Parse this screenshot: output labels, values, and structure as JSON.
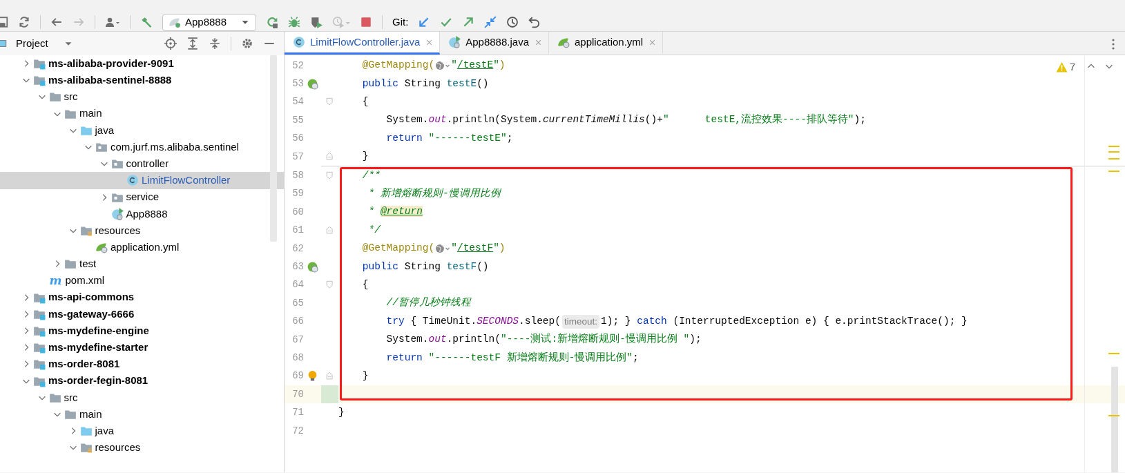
{
  "toolbar": {
    "buttons": [
      {
        "kind": "save",
        "disabled": false
      },
      {
        "kind": "sync",
        "disabled": false
      },
      {
        "kind": "separator"
      },
      {
        "kind": "back",
        "disabled": false
      },
      {
        "kind": "forward",
        "disabled": true
      },
      {
        "kind": "separator"
      },
      {
        "kind": "user",
        "disabled": false
      },
      {
        "kind": "separator"
      },
      {
        "kind": "build",
        "disabled": false
      },
      {
        "kind": "run-config",
        "label": "App8888"
      },
      {
        "kind": "rerun",
        "disabled": false
      },
      {
        "kind": "debug",
        "disabled": false
      },
      {
        "kind": "coverage",
        "disabled": false
      },
      {
        "kind": "profile",
        "disabled": true
      },
      {
        "kind": "stop",
        "disabled": false
      },
      {
        "kind": "separator"
      },
      {
        "kind": "label",
        "label": "Git:"
      },
      {
        "kind": "update",
        "disabled": false
      },
      {
        "kind": "commit",
        "disabled": false
      },
      {
        "kind": "push",
        "disabled": false
      },
      {
        "kind": "merge",
        "disabled": false
      },
      {
        "kind": "history",
        "disabled": false
      },
      {
        "kind": "revert",
        "disabled": false
      }
    ]
  },
  "project_panel": {
    "title": "Project",
    "tree": [
      {
        "name": "ms-alibaba-provider-9091",
        "kind": "module",
        "expanded": false,
        "selected": false
      },
      {
        "name": "ms-alibaba-sentinel-8888",
        "kind": "module",
        "expanded": true,
        "selected": false,
        "children": [
          {
            "name": "src",
            "kind": "folder",
            "expanded": true,
            "selected": false,
            "children": [
              {
                "name": "main",
                "kind": "folder",
                "expanded": true,
                "selected": false,
                "children": [
                  {
                    "name": "java",
                    "kind": "source-root",
                    "expanded": true,
                    "selected": false,
                    "children": [
                      {
                        "name": "com.jurf.ms.alibaba.sentinel",
                        "kind": "package",
                        "expanded": true,
                        "selected": false,
                        "children": [
                          {
                            "name": "controller",
                            "kind": "package",
                            "expanded": true,
                            "selected": false,
                            "children": [
                              {
                                "name": "LimitFlowController",
                                "kind": "class",
                                "selected": true
                              }
                            ]
                          },
                          {
                            "name": "service",
                            "kind": "package",
                            "expanded": false,
                            "selected": false
                          },
                          {
                            "name": "App8888",
                            "kind": "app-class",
                            "selected": false
                          }
                        ]
                      }
                    ]
                  },
                  {
                    "name": "resources",
                    "kind": "resources",
                    "expanded": true,
                    "selected": false,
                    "children": [
                      {
                        "name": "application.yml",
                        "kind": "yml",
                        "selected": false
                      }
                    ]
                  }
                ]
              },
              {
                "name": "test",
                "kind": "folder",
                "expanded": false,
                "selected": false
              }
            ]
          },
          {
            "name": "pom.xml",
            "kind": "maven",
            "icon_text": "m",
            "selected": false
          }
        ]
      },
      {
        "name": "ms-api-commons",
        "kind": "module",
        "expanded": false,
        "selected": false
      },
      {
        "name": "ms-gateway-6666",
        "kind": "module",
        "expanded": false,
        "selected": false
      },
      {
        "name": "ms-mydefine-engine",
        "kind": "module",
        "expanded": false,
        "selected": false
      },
      {
        "name": "ms-mydefine-starter",
        "kind": "module",
        "expanded": false,
        "selected": false
      },
      {
        "name": "ms-order-8081",
        "kind": "module",
        "expanded": false,
        "selected": false
      },
      {
        "name": "ms-order-fegin-8081",
        "kind": "module",
        "expanded": true,
        "selected": false,
        "children": [
          {
            "name": "src",
            "kind": "folder",
            "expanded": true,
            "selected": false,
            "children": [
              {
                "name": "main",
                "kind": "folder",
                "expanded": true,
                "selected": false,
                "children": [
                  {
                    "name": "java",
                    "kind": "source-root",
                    "expanded": false,
                    "selected": false
                  },
                  {
                    "name": "resources",
                    "kind": "resources",
                    "expanded": true,
                    "selected": false
                  }
                ]
              }
            ]
          }
        ]
      }
    ]
  },
  "editor": {
    "tabs": [
      {
        "label": "LimitFlowController.java",
        "kind": "class",
        "selected": true
      },
      {
        "label": "App8888.java",
        "kind": "app-class",
        "selected": false
      },
      {
        "label": "application.yml",
        "kind": "yml",
        "selected": false
      }
    ],
    "warnings": "7",
    "blocks": [
      {
        "highlighted": false,
        "separator_before": false,
        "lines": [
          {
            "number": "52",
            "current": false,
            "changed": false,
            "tokens": [
              {
                "kind": "anno",
                "text": "    @GetMapping("
              },
              {
                "kind": "globe"
              },
              {
                "kind": "str",
                "text": "\""
              },
              {
                "kind": "url",
                "text": "/testE"
              },
              {
                "kind": "str",
                "text": "\""
              },
              {
                "kind": "anno",
                "text": ")"
              }
            ]
          },
          {
            "number": "53",
            "gutter": {
              "kind": "run"
            },
            "current": false,
            "changed": false,
            "tokens": [
              {
                "kind": "kw",
                "text": "    public "
              },
              {
                "kind": "plain",
                "text": "String "
              },
              {
                "kind": "decl",
                "text": "testE"
              },
              {
                "kind": "plain",
                "text": "()"
              }
            ]
          },
          {
            "number": "54",
            "fold": {
              "kind": "start"
            },
            "current": false,
            "changed": false,
            "tokens": [
              {
                "kind": "plain",
                "text": "    {"
              }
            ]
          },
          {
            "number": "55",
            "current": false,
            "changed": false,
            "tokens": [
              {
                "kind": "plain",
                "text": "        System."
              },
              {
                "kind": "sf",
                "text": "out"
              },
              {
                "kind": "plain",
                "text": ".println(System."
              },
              {
                "kind": "sm",
                "text": "currentTimeMillis"
              },
              {
                "kind": "plain",
                "text": "()+"
              },
              {
                "kind": "str",
                "text": "\"      testE,流控效果----排队等待\""
              },
              {
                "kind": "plain",
                "text": ");"
              }
            ]
          },
          {
            "number": "56",
            "current": false,
            "changed": false,
            "tokens": [
              {
                "kind": "kw",
                "text": "        return "
              },
              {
                "kind": "str",
                "text": "\"------testE\""
              },
              {
                "kind": "plain",
                "text": ";"
              }
            ]
          },
          {
            "number": "57",
            "fold": {
              "kind": "end"
            },
            "current": false,
            "changed": false,
            "tokens": [
              {
                "kind": "plain",
                "text": "    }"
              }
            ]
          }
        ]
      },
      {
        "highlighted": true,
        "separator_before": true,
        "lines": [
          {
            "number": "58",
            "fold": {
              "kind": "start"
            },
            "current": false,
            "changed": false,
            "tokens": [
              {
                "kind": "doc",
                "text": "    /**"
              }
            ]
          },
          {
            "number": "59",
            "current": false,
            "changed": false,
            "tokens": [
              {
                "kind": "doc",
                "text": "     * 新增熔断规则-慢调用比例"
              }
            ]
          },
          {
            "number": "60",
            "current": false,
            "changed": false,
            "tokens": [
              {
                "kind": "doc",
                "text": "     * "
              },
              {
                "kind": "tag",
                "text": "@return"
              }
            ]
          },
          {
            "number": "61",
            "fold": {
              "kind": "end"
            },
            "current": false,
            "changed": false,
            "tokens": [
              {
                "kind": "doc",
                "text": "     */"
              }
            ]
          },
          {
            "number": "62",
            "current": false,
            "changed": false,
            "tokens": [
              {
                "kind": "anno",
                "text": "    @GetMapping("
              },
              {
                "kind": "globe"
              },
              {
                "kind": "str",
                "text": "\""
              },
              {
                "kind": "url",
                "text": "/testF"
              },
              {
                "kind": "str",
                "text": "\""
              },
              {
                "kind": "anno",
                "text": ")"
              }
            ]
          },
          {
            "number": "63",
            "gutter": {
              "kind": "run"
            },
            "current": false,
            "changed": false,
            "tokens": [
              {
                "kind": "kw",
                "text": "    public "
              },
              {
                "kind": "plain",
                "text": "String "
              },
              {
                "kind": "decl",
                "text": "testF"
              },
              {
                "kind": "plain",
                "text": "()"
              }
            ]
          },
          {
            "number": "64",
            "fold": {
              "kind": "start"
            },
            "current": false,
            "changed": false,
            "tokens": [
              {
                "kind": "plain",
                "text": "    {"
              }
            ]
          },
          {
            "number": "65",
            "current": false,
            "changed": false,
            "tokens": [
              {
                "kind": "doc",
                "text": "        //暂停几秒钟线程"
              }
            ]
          },
          {
            "number": "66",
            "current": false,
            "changed": false,
            "tokens": [
              {
                "kind": "kw",
                "text": "        try "
              },
              {
                "kind": "plain",
                "text": "{ TimeUnit."
              },
              {
                "kind": "sf",
                "text": "SECONDS"
              },
              {
                "kind": "plain",
                "text": ".sleep("
              },
              {
                "kind": "hint",
                "text": "timeout:"
              },
              {
                "kind": "plain",
                "text": "1); } "
              },
              {
                "kind": "kw",
                "text": "catch "
              },
              {
                "kind": "plain",
                "text": "(InterruptedException e) { e.printStackTrace(); }"
              }
            ]
          },
          {
            "number": "67",
            "current": false,
            "changed": false,
            "tokens": [
              {
                "kind": "plain",
                "text": "        System."
              },
              {
                "kind": "sf",
                "text": "out"
              },
              {
                "kind": "plain",
                "text": ".println("
              },
              {
                "kind": "str",
                "text": "\"----测试:新增熔断规则-慢调用比例 \""
              },
              {
                "kind": "plain",
                "text": ");"
              }
            ]
          },
          {
            "number": "68",
            "current": false,
            "changed": false,
            "tokens": [
              {
                "kind": "kw",
                "text": "        return "
              },
              {
                "kind": "str",
                "text": "\"------testF 新增熔断规则-慢调用比例\""
              },
              {
                "kind": "plain",
                "text": ";"
              }
            ]
          },
          {
            "number": "69",
            "gutter": {
              "kind": "bulb"
            },
            "fold": {
              "kind": "end"
            },
            "current": false,
            "changed": false,
            "tokens": [
              {
                "kind": "plain",
                "text": "    }"
              }
            ]
          },
          {
            "number": "70",
            "current": true,
            "changed": true
          }
        ]
      },
      {
        "highlighted": false,
        "separator_before": false,
        "lines": [
          {
            "number": "71",
            "current": false,
            "changed": false,
            "tokens": [
              {
                "kind": "plain",
                "text": "}"
              }
            ]
          },
          {
            "number": "72",
            "current": false,
            "changed": false
          }
        ]
      }
    ]
  }
}
